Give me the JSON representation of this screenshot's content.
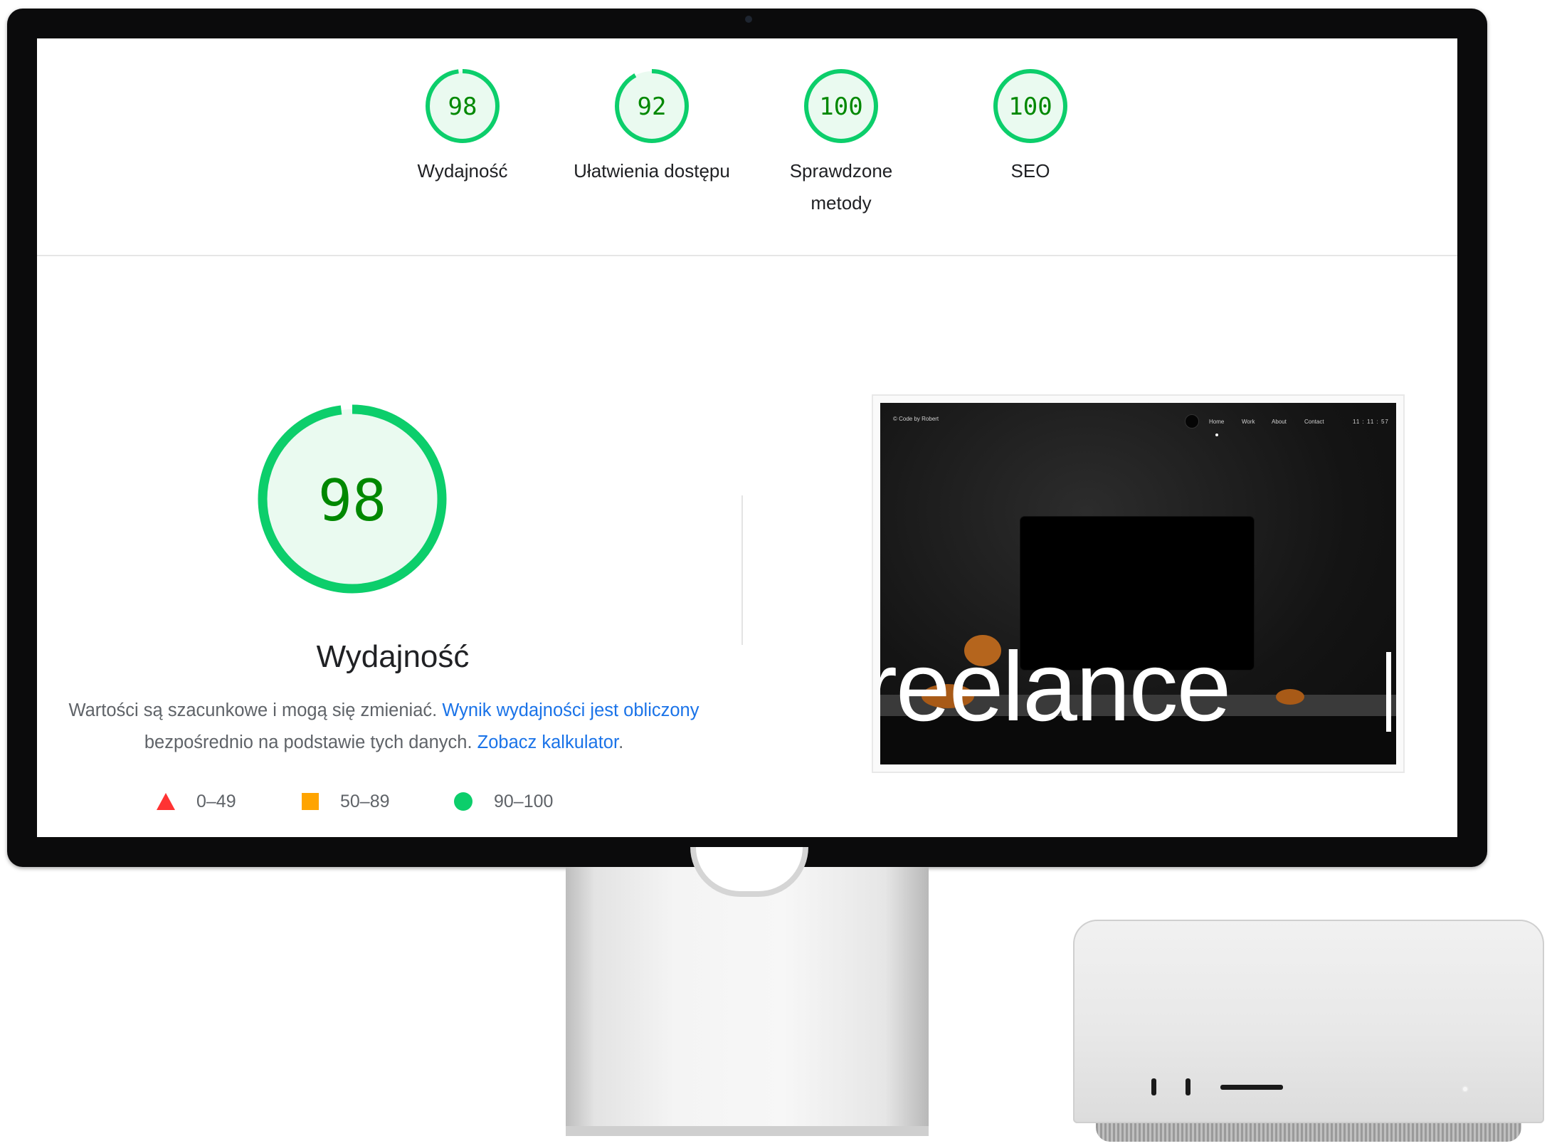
{
  "categories": [
    {
      "score": "98",
      "label": "Wydajność",
      "fraction": 0.98
    },
    {
      "score": "92",
      "label": "Ułatwienia dostępu",
      "fraction": 0.92
    },
    {
      "score": "100",
      "label": "Sprawdzone metody",
      "fraction": 1.0
    },
    {
      "score": "100",
      "label": "SEO",
      "fraction": 1.0
    }
  ],
  "performance": {
    "score": "98",
    "fraction": 0.98,
    "title": "Wydajność",
    "desc_part1": "Wartości są szacunkowe i mogą się zmieniać. ",
    "desc_link1": "Wynik wydajności jest obliczony",
    "desc_part2": " bezpośrednio na podstawie tych danych. ",
    "desc_link2": "Zobacz kalkulator",
    "desc_part3": "."
  },
  "legend": [
    {
      "range": "0–49",
      "shape": "triangle",
      "color": "#ff3333"
    },
    {
      "range": "50–89",
      "shape": "square",
      "color": "#ffa400"
    },
    {
      "range": "90–100",
      "shape": "circle",
      "color": "#0cce6b"
    }
  ],
  "thumbnail": {
    "brand": "© Code by Robert",
    "nav": [
      "Home",
      "Work",
      "About",
      "Contact"
    ],
    "time": "11 : 11 : 57",
    "headline": "reelance"
  },
  "colors": {
    "pass_green": "#0cce6b",
    "pass_text": "#008800",
    "gauge_fill": "#eafaf0",
    "link_blue": "#1a73e8"
  }
}
